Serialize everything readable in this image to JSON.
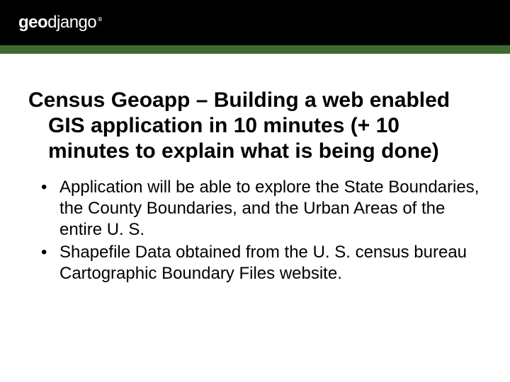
{
  "header": {
    "logo_geo": "geo",
    "logo_django": "django",
    "logo_reg": "®"
  },
  "slide": {
    "title": "Census Geoapp – Building a web enabled GIS application in 10 minutes (+ 10 minutes to explain what is being done)",
    "bullets": [
      "Application will be able to explore the State Boundaries, the County Boundaries, and the Urban Areas of the entire U. S.",
      "Shapefile Data obtained from the U. S. census bureau Cartographic Boundary Files website."
    ]
  }
}
